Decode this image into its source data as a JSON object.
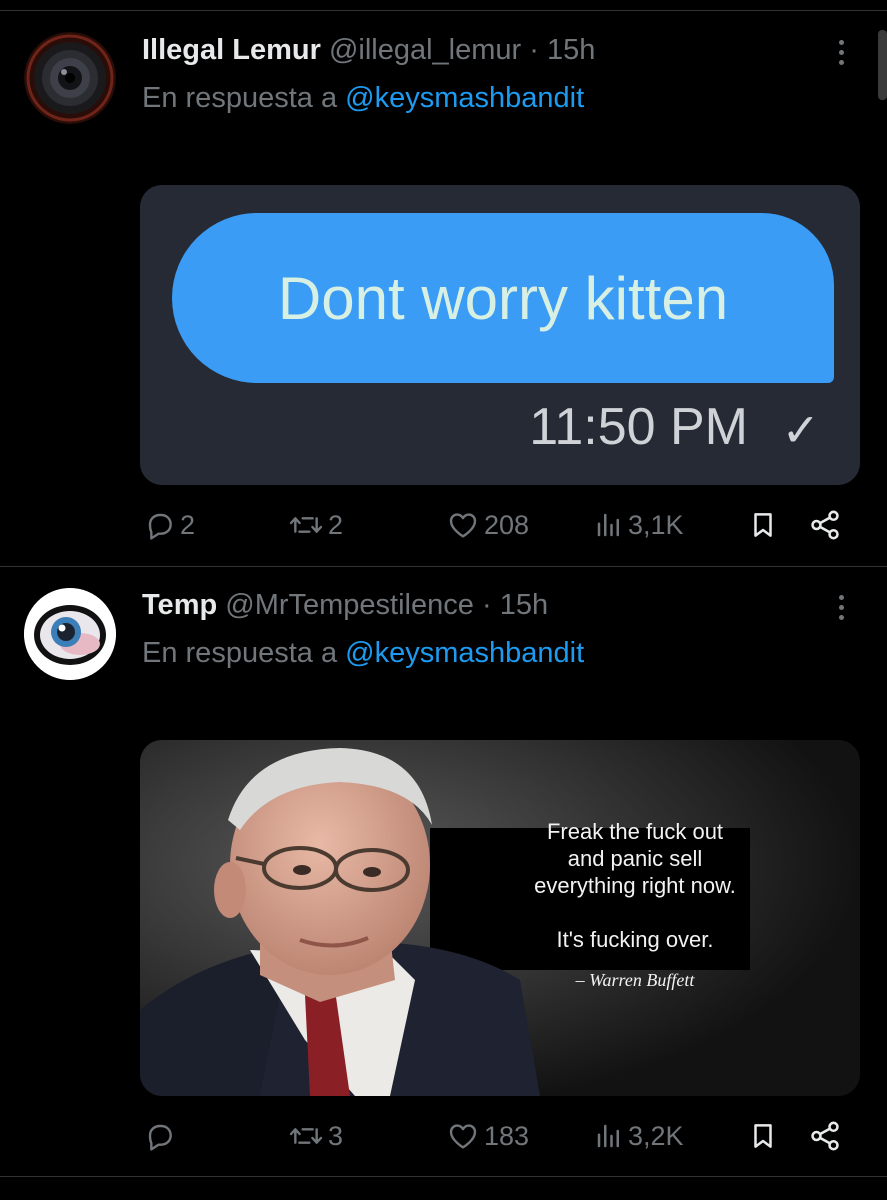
{
  "tweets": [
    {
      "display_name": "Illegal Lemur",
      "handle": "@illegal_lemur",
      "separator": "·",
      "time": "15h",
      "reply_prefix": "En respuesta a",
      "reply_to": "@keysmashbandit",
      "media": {
        "bubble_text": "Dont worry kitten",
        "timestamp": "11:50 PM",
        "check": "✓",
        "bubble_color": "#3a9cf5",
        "background_color": "#262a34"
      },
      "stats": {
        "replies": "2",
        "reposts": "2",
        "likes": "208",
        "views": "3,1K"
      }
    },
    {
      "display_name": "Temp",
      "handle": "@MrTempestilence",
      "separator": "·",
      "time": "15h",
      "reply_prefix": "En respuesta a",
      "reply_to": "@keysmashbandit",
      "media": {
        "quote_line1": "Freak the fuck out",
        "quote_line2": "and panic sell",
        "quote_line3": "everything right now.",
        "quote_line4": "It's fucking over.",
        "attribution": "– Warren Buffett"
      },
      "stats": {
        "replies": "",
        "reposts": "3",
        "likes": "183",
        "views": "3,2K"
      }
    }
  ],
  "icons": [
    "reply-icon",
    "repost-icon",
    "like-icon",
    "views-icon",
    "bookmark-icon",
    "share-icon",
    "more-icon"
  ],
  "colors": {
    "background": "#000000",
    "text": "#e7e9ea",
    "muted": "#71767b",
    "link": "#1d9bf0",
    "divider": "#2f3336"
  }
}
